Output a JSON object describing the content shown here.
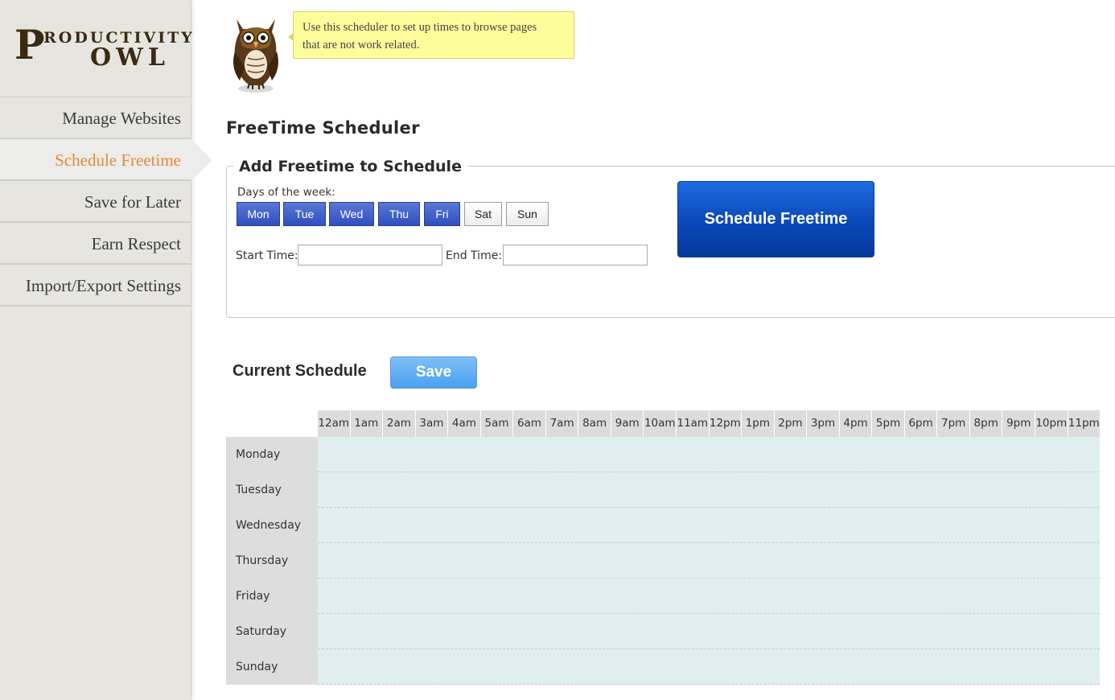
{
  "logo": {
    "initial": "P",
    "line1": "RODUCTIVITY",
    "line2": "OWL"
  },
  "sidebar": {
    "items": [
      {
        "label": "Manage Websites"
      },
      {
        "label": "Schedule Freetime"
      },
      {
        "label": "Save for Later"
      },
      {
        "label": "Earn Respect"
      },
      {
        "label": "Import/Export Settings"
      }
    ],
    "active_index": 1
  },
  "tooltip": {
    "line1": "Use this scheduler to set up times to browse pages",
    "line2": "that are not work related."
  },
  "page_title": "FreeTime Scheduler",
  "add_section": {
    "legend": "Add Freetime to Schedule",
    "days_label": "Days of the week:",
    "days": [
      {
        "label": "Mon",
        "selected": true
      },
      {
        "label": "Tue",
        "selected": true
      },
      {
        "label": "Wed",
        "selected": true
      },
      {
        "label": "Thu",
        "selected": true
      },
      {
        "label": "Fri",
        "selected": true
      },
      {
        "label": "Sat",
        "selected": false
      },
      {
        "label": "Sun",
        "selected": false
      }
    ],
    "start_label": "Start Time:",
    "start_value": "",
    "end_label": "End Time:",
    "end_value": "",
    "submit_label": "Schedule Freetime"
  },
  "current_schedule": {
    "title": "Current Schedule",
    "save_label": "Save",
    "hours": [
      "12am",
      "1am",
      "2am",
      "3am",
      "4am",
      "5am",
      "6am",
      "7am",
      "8am",
      "9am",
      "10am",
      "11am",
      "12pm",
      "1pm",
      "2pm",
      "3pm",
      "4pm",
      "5pm",
      "6pm",
      "7pm",
      "8pm",
      "9pm",
      "10pm",
      "11pm"
    ],
    "days": [
      "Monday",
      "Tuesday",
      "Wednesday",
      "Thursday",
      "Friday",
      "Saturday",
      "Sunday"
    ]
  },
  "colors": {
    "accent_active_nav": "#e08a38",
    "day_selected": "#2f4fbf",
    "primary_button": "#0a48b8",
    "save_button": "#4a9ff0",
    "tooltip_bg": "#fefd9c",
    "grid_bg": "#e1eef0"
  },
  "icons": {
    "mascot": "owl-icon"
  }
}
